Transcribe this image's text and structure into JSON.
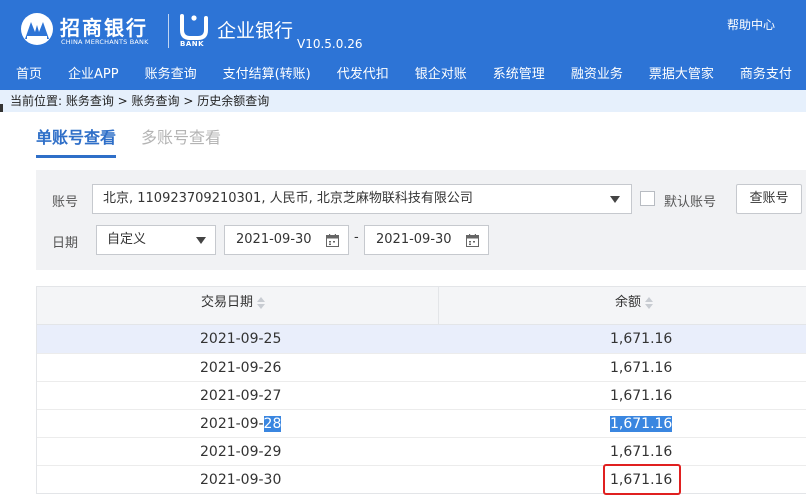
{
  "header": {
    "bank_name_cn": "招商银行",
    "bank_name_en": "CHINA MERCHANTS BANK",
    "ibank_label": "BANK",
    "title": "企业银行",
    "version": "V10.5.0.26",
    "help": "帮助中心",
    "brand_color": "#2d74d6"
  },
  "nav": {
    "items": [
      "首页",
      "企业APP",
      "账务查询",
      "支付结算(转账)",
      "代发代扣",
      "银企对账",
      "系统管理",
      "融资业务",
      "票据大管家",
      "商务支付"
    ]
  },
  "breadcrumb": "当前位置: 账务查询 > 账务查询 > 历史余额查询",
  "tabs": [
    {
      "label": "单账号查看",
      "active": true
    },
    {
      "label": "多账号查看",
      "active": false
    }
  ],
  "filter": {
    "account_label": "账号",
    "account_value": "北京, 110923709210301, 人民币, 北京芝麻物联科技有限公司",
    "default_account_label": "默认账号",
    "query_account_button": "查账号",
    "date_label": "日期",
    "date_type": "自定义",
    "start_date": "2021-09-30",
    "end_date": "2021-09-30",
    "range_separator": "-"
  },
  "table": {
    "columns": [
      "交易日期",
      "余额"
    ],
    "rows": [
      {
        "date_prefix": "2021-09-25",
        "date_highlight": "",
        "balance": "1,671.16"
      },
      {
        "date_prefix": "2021-09-26",
        "date_highlight": "",
        "balance": "1,671.16"
      },
      {
        "date_prefix": "2021-09-27",
        "date_highlight": "",
        "balance": "1,671.16"
      },
      {
        "date_prefix": "2021-09-",
        "date_highlight": "28",
        "balance": "1,671.16"
      },
      {
        "date_prefix": "2021-09-29",
        "date_highlight": "",
        "balance": "1,671.16"
      },
      {
        "date_prefix": "2021-09-30",
        "date_highlight": "",
        "balance": "1,671.16"
      }
    ]
  },
  "icons": [
    "cmb-logo-icon",
    "ibank-logo-icon",
    "dropdown-caret-icon",
    "calendar-icon",
    "sort-icon"
  ]
}
